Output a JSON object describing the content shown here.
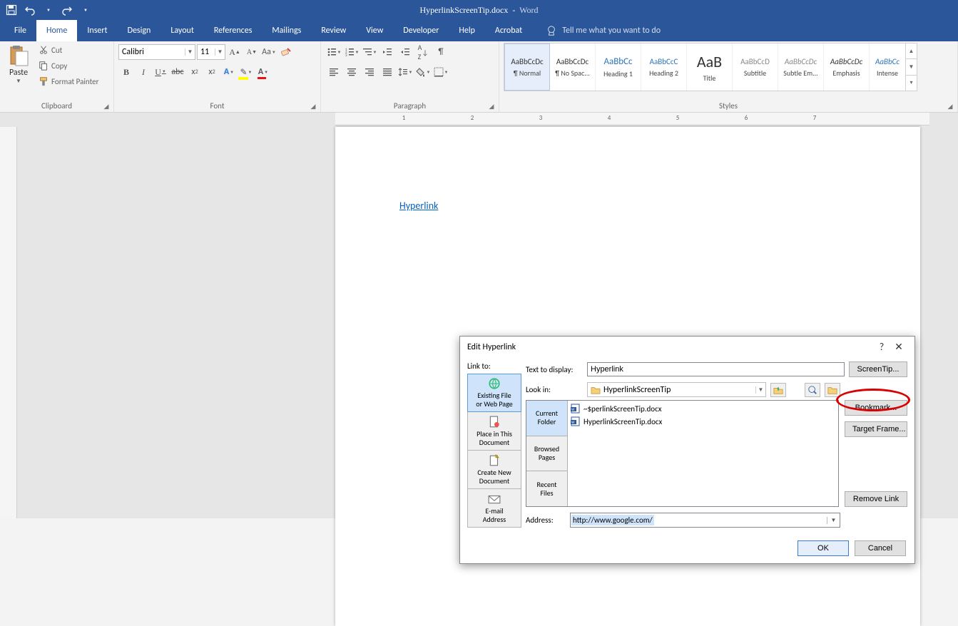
{
  "title": {
    "doc": "HyperlinkScreenTip.docx",
    "app": "Word"
  },
  "tabs": {
    "file": "File",
    "home": "Home",
    "insert": "Insert",
    "design": "Design",
    "layout": "Layout",
    "references": "References",
    "mailings": "Mailings",
    "review": "Review",
    "view": "View",
    "developer": "Developer",
    "help": "Help",
    "acrobat": "Acrobat",
    "tell": "Tell me what you want to do"
  },
  "ribbon": {
    "clipboard": {
      "title": "Clipboard",
      "paste": "Paste",
      "cut": "Cut",
      "copy": "Copy",
      "format_painter": "Format Painter"
    },
    "font": {
      "title": "Font",
      "name": "Calibri",
      "size": "11"
    },
    "paragraph": {
      "title": "Paragraph"
    },
    "styles": {
      "title": "Styles",
      "items": [
        "¶ Normal",
        "¶ No Spac...",
        "Heading 1",
        "Heading 2",
        "Title",
        "Subtitle",
        "Subtle Em...",
        "Emphasis",
        "Intense"
      ],
      "previews": [
        "AaBbCcDc",
        "AaBbCcDc",
        "AaBbCc",
        "AaBbCcC",
        "AaB",
        "AaBbCcD",
        "AaBbCcDc",
        "AaBbCcDc",
        "AaBbCc"
      ]
    }
  },
  "doc_text": {
    "hyperlink": "Hyperlink"
  },
  "dialog": {
    "title": "Edit Hyperlink",
    "link_to": "Link to:",
    "link_opts": {
      "existing": "Existing File\nor Web Page",
      "place": "Place in This\nDocument",
      "new": "Create New\nDocument",
      "email": "E-mail\nAddress"
    },
    "text_to_display": "Text to display:",
    "tdd_value": "Hyperlink",
    "screentip": "ScreenTip...",
    "look_in": "Look in:",
    "look_in_val": "HyperlinkScreenTip",
    "btabs": {
      "current": "Current\nFolder",
      "browsed": "Browsed\nPages",
      "recent": "Recent\nFiles"
    },
    "files": [
      "~$perlinkScreenTip.docx",
      "HyperlinkScreenTip.docx"
    ],
    "bookmark": "Bookmark...",
    "target_frame": "Target Frame...",
    "address": "Address:",
    "address_val": "http://www.google.com/",
    "remove_link": "Remove Link",
    "ok": "OK",
    "cancel": "Cancel"
  }
}
